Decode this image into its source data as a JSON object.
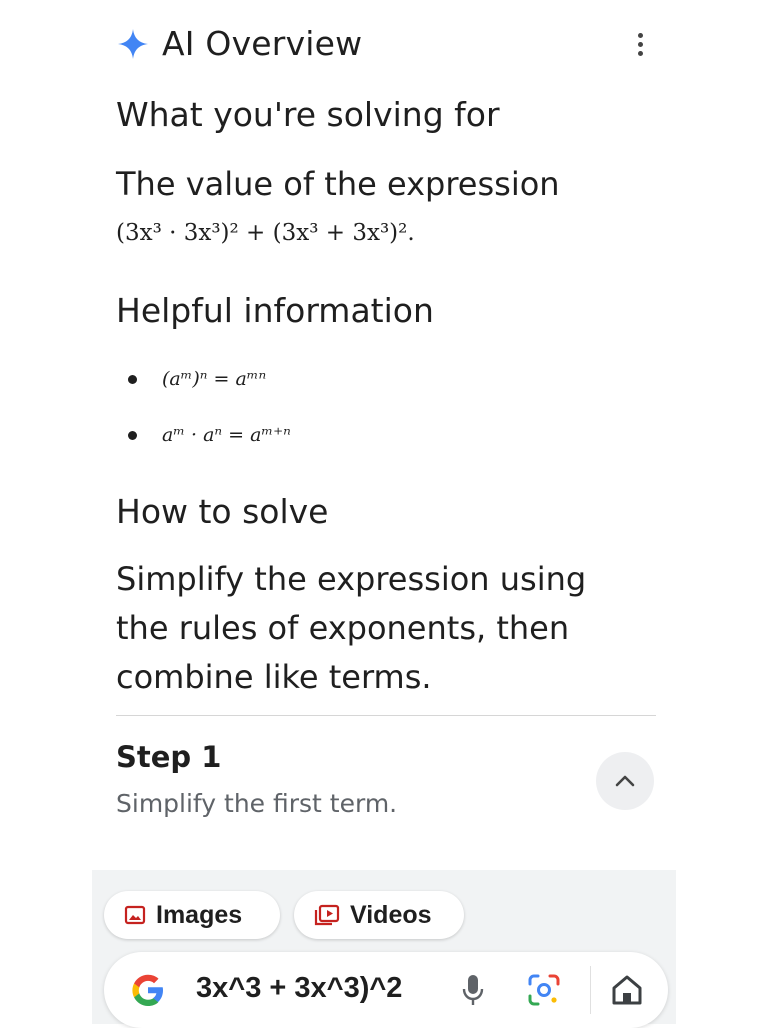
{
  "overview": {
    "title": "AI Overview"
  },
  "sections": {
    "solving_heading": "What you're solving for",
    "solving_text": "The value of the expression",
    "expression": "(3x³ · 3x³)² + (3x³ + 3x³)².",
    "helpful_heading": "Helpful information",
    "rules": [
      "(aᵐ)ⁿ = aᵐⁿ",
      "aᵐ · aⁿ = aᵐ⁺ⁿ"
    ],
    "how_heading": "How to solve",
    "how_text_lines": [
      "Simplify the expression using",
      "the rules of exponents, then",
      "combine like terms."
    ]
  },
  "step": {
    "title": "Step 1",
    "description": "Simplify the first term."
  },
  "chips": {
    "images": "Images",
    "videos": "Videos"
  },
  "search": {
    "query": "3x^3 + 3x^3)^2"
  },
  "icons": [
    "spark-icon",
    "more-vert-icon",
    "chevron-up-icon",
    "images-icon",
    "videos-icon",
    "google-logo-icon",
    "mic-icon",
    "lens-icon",
    "home-icon"
  ],
  "colors": {
    "accent_blue": "#4285F4",
    "chip_icon_red": "#c5221f"
  }
}
